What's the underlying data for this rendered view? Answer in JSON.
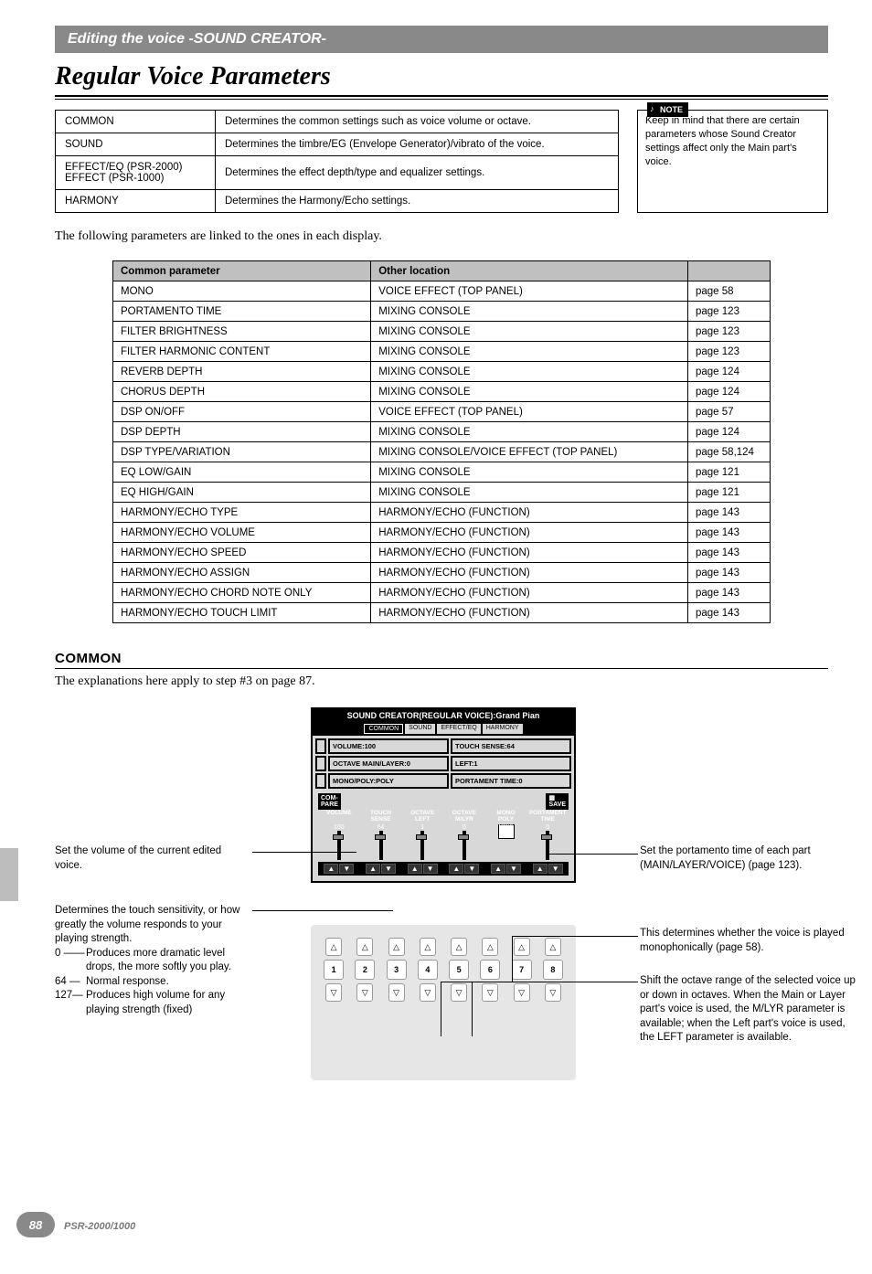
{
  "header": {
    "text": "Editing the voice  -SOUND CREATOR-"
  },
  "title": "Regular Voice Parameters",
  "cat_table": [
    {
      "name": "COMMON",
      "desc": "Determines the common settings such as voice volume or octave."
    },
    {
      "name": "SOUND",
      "desc": "Determines the timbre/EG (Envelope Generator)/vibrato of the voice."
    },
    {
      "name": "EFFECT/EQ (PSR-2000)\nEFFECT (PSR-1000)",
      "desc": "Determines the effect depth/type and equalizer settings."
    },
    {
      "name": "HARMONY",
      "desc": "Determines the Harmony/Echo settings."
    }
  ],
  "note": {
    "label": "NOTE",
    "text": "Keep in mind that there are certain parameters whose Sound Creator settings affect only the Main part's voice."
  },
  "linked_intro": "The following parameters are linked to the ones in each display.",
  "linked_headers": {
    "c1": "Common parameter",
    "c2": "Other location",
    "c3": ""
  },
  "linked_rows": [
    {
      "p": "MONO",
      "loc": "VOICE EFFECT (TOP PANEL)",
      "pg": "page 58"
    },
    {
      "p": "PORTAMENTO TIME",
      "loc": "MIXING CONSOLE",
      "pg": "page 123"
    },
    {
      "p": "FILTER BRIGHTNESS",
      "loc": "MIXING CONSOLE",
      "pg": "page 123"
    },
    {
      "p": "FILTER HARMONIC CONTENT",
      "loc": "MIXING CONSOLE",
      "pg": "page 123"
    },
    {
      "p": "REVERB DEPTH",
      "loc": "MIXING CONSOLE",
      "pg": "page 124"
    },
    {
      "p": "CHORUS DEPTH",
      "loc": "MIXING CONSOLE",
      "pg": "page 124"
    },
    {
      "p": "DSP ON/OFF",
      "loc": "VOICE EFFECT (TOP PANEL)",
      "pg": "page 57"
    },
    {
      "p": "DSP DEPTH",
      "loc": "MIXING CONSOLE",
      "pg": "page 124"
    },
    {
      "p": "DSP TYPE/VARIATION",
      "loc": "MIXING CONSOLE/VOICE EFFECT (TOP PANEL)",
      "pg": "page 58,124"
    },
    {
      "p": "EQ LOW/GAIN",
      "loc": "MIXING CONSOLE",
      "pg": "page 121"
    },
    {
      "p": "EQ HIGH/GAIN",
      "loc": "MIXING CONSOLE",
      "pg": "page 121"
    },
    {
      "p": "HARMONY/ECHO TYPE",
      "loc": "HARMONY/ECHO (FUNCTION)",
      "pg": "page 143"
    },
    {
      "p": "HARMONY/ECHO VOLUME",
      "loc": "HARMONY/ECHO (FUNCTION)",
      "pg": "page 143"
    },
    {
      "p": "HARMONY/ECHO SPEED",
      "loc": "HARMONY/ECHO (FUNCTION)",
      "pg": "page 143"
    },
    {
      "p": "HARMONY/ECHO ASSIGN",
      "loc": "HARMONY/ECHO (FUNCTION)",
      "pg": "page 143"
    },
    {
      "p": "HARMONY/ECHO CHORD NOTE ONLY",
      "loc": "HARMONY/ECHO (FUNCTION)",
      "pg": "page 143"
    },
    {
      "p": "HARMONY/ECHO TOUCH LIMIT",
      "loc": "HARMONY/ECHO (FUNCTION)",
      "pg": "page 143"
    }
  ],
  "common": {
    "heading": "COMMON",
    "intro": "The explanations here apply to step #3 on page 87."
  },
  "screen": {
    "title": "SOUND CREATOR(REGULAR VOICE):Grand Pian",
    "tabs": [
      "COMMON",
      "SOUND",
      "EFFECT/EQ",
      "HARMONY"
    ],
    "cells": {
      "volume": "VOLUME:100",
      "touch": "TOUCH SENSE:64",
      "octave": "OCTAVE MAIN/LAYER:0",
      "left": "LEFT:1",
      "monopoly": "MONO/POLY:POLY",
      "porta": "PORTAMENT TIME:0"
    },
    "compare": "COM-\nPARE",
    "save": "▦\nSAVE",
    "slider_heads": [
      "VOLUME",
      "TOUCH\nSENSE",
      "OCTAVE\nLEFT",
      "OCTAVE\nM/LYR",
      "MONO\nPOLY",
      "PORTAMENT\nTIME"
    ],
    "slider_vals": [
      "100",
      "64",
      "1",
      "0",
      "",
      "0"
    ],
    "mono_labels": "MONO\nPOLY"
  },
  "phys_numbers": [
    "1",
    "2",
    "3",
    "4",
    "5",
    "6",
    "7",
    "8"
  ],
  "callouts": {
    "left1": "Set the volume of the current edited voice.",
    "left2_intro": "Determines the touch sensitivity, or how greatly the volume responds to your playing strength.",
    "left2_items": [
      {
        "n": "0 ——",
        "t": "Produces more dramatic level drops, the more softly you play."
      },
      {
        "n": "64 —",
        "t": "Normal response."
      },
      {
        "n": "127—",
        "t": "Produces high volume for any playing strength (fixed)"
      }
    ],
    "right1": "Set the portamento time of each part (MAIN/LAYER/VOICE) (page 123).",
    "right2": "This determines whether the voice is played monophonically (page 58).",
    "right3": "Shift the octave range of the selected voice up or down in octaves. When the Main or Layer part's voice is used, the M/LYR parameter is available; when the Left part's voice is used, the LEFT parameter is available."
  },
  "footer": {
    "page": "88",
    "model": "PSR-2000/1000"
  }
}
